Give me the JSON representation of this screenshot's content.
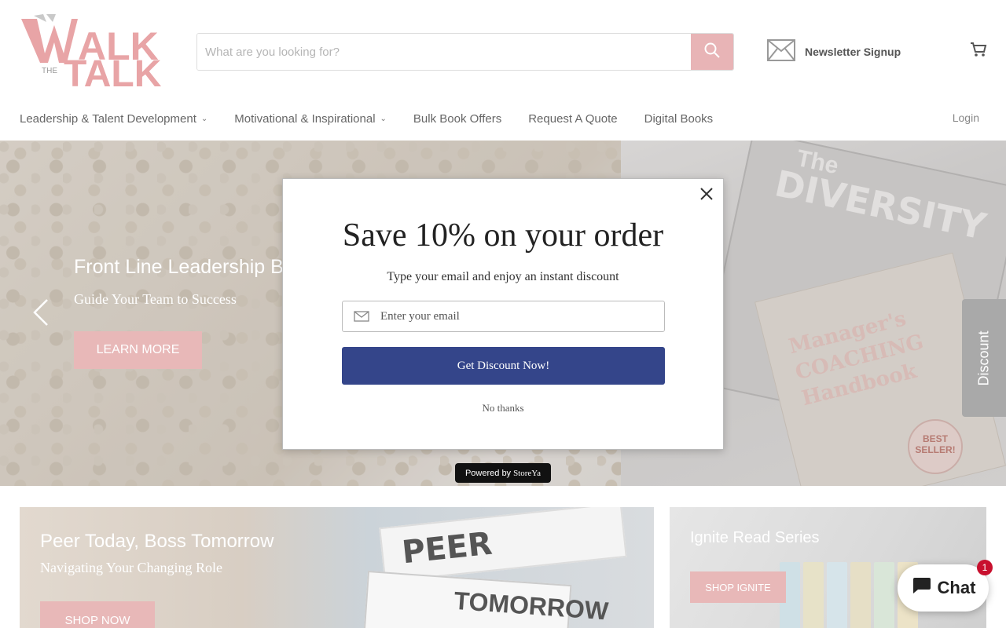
{
  "logo": {
    "text_top": "WALK",
    "text_the": "THE",
    "text_bottom": "TALK",
    "color": "#e8a4a6"
  },
  "search": {
    "placeholder": "What are you looking for?"
  },
  "newsletter": {
    "label": "Newsletter Signup"
  },
  "nav": {
    "items": [
      {
        "label": "Leadership & Talent Development",
        "has_dropdown": true
      },
      {
        "label": "Motivational & Inspirational",
        "has_dropdown": true
      },
      {
        "label": "Bulk Book Offers",
        "has_dropdown": false
      },
      {
        "label": "Request A Quote",
        "has_dropdown": false
      },
      {
        "label": "Digital Books",
        "has_dropdown": false
      }
    ],
    "login_label": "Login"
  },
  "hero": {
    "title": "Front Line Leadership B",
    "subtitle": "Guide Your Team to Success",
    "button_label": "LEARN MORE",
    "book1_line1": "The",
    "book1_line2": "DIVERSITY",
    "book2_title": "Manager's COACHING Handbook",
    "badge_text": "BEST SELLER!"
  },
  "discount_tab": {
    "label": "Discount"
  },
  "popup": {
    "title": "Save 10% on your order",
    "subtitle": "Type your email and enjoy an instant discount",
    "email_placeholder": "Enter your email",
    "button_label": "Get Discount Now!",
    "dismiss_label": "No thanks",
    "powered_by": "Powered by",
    "powered_brand": "StoreYa",
    "button_color": "#34458a"
  },
  "tiles": {
    "left": {
      "title": "Peer Today, Boss Tomorrow",
      "subtitle": "Navigating Your Changing Role",
      "button_label": "SHOP NOW",
      "sign_text_1": "PEER",
      "sign_text_2": "TOMORROW"
    },
    "right": {
      "title": "Ignite Read Series",
      "button_label": "SHOP IGNITE"
    }
  },
  "chat": {
    "label": "Chat",
    "badge_count": "1"
  },
  "colors": {
    "accent": "#e8b8b8",
    "chat_badge": "#c8102e"
  }
}
